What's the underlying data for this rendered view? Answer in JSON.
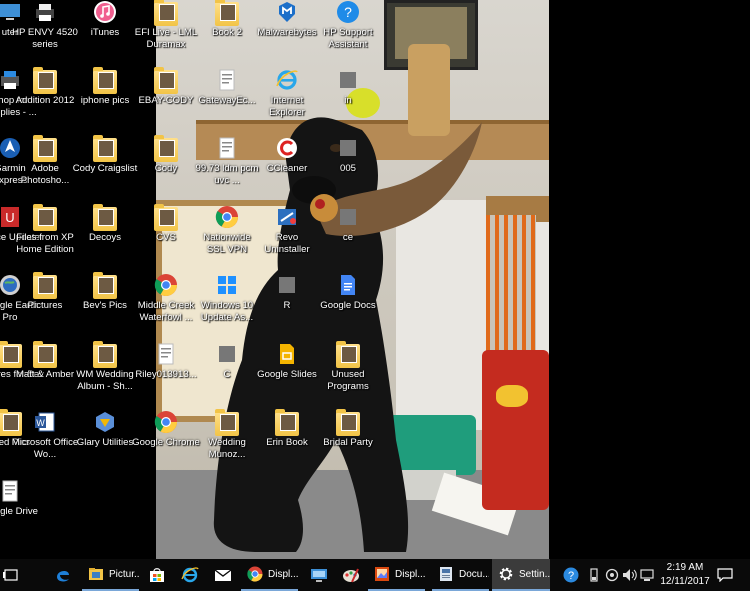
{
  "desktop": {
    "icons": [
      {
        "label": "uter",
        "kind": "computer"
      },
      {
        "label": "HP ENVY 4520 series",
        "kind": "printer"
      },
      {
        "label": "iTunes",
        "kind": "itunes"
      },
      {
        "label": "EFI Live - LML Duramax",
        "kind": "folder"
      },
      {
        "label": "Book 2",
        "kind": "folder"
      },
      {
        "label": "Malwarebytes",
        "kind": "malwarebytes"
      },
      {
        "label": "HP Support Assistant",
        "kind": "hp-support"
      },
      {
        "label": "Shop for Supplies - ...",
        "kind": "shop"
      },
      {
        "label": "Addition 2012",
        "kind": "folder"
      },
      {
        "label": "iphone pics",
        "kind": "folder"
      },
      {
        "label": "EBAY-CODY",
        "kind": "folder"
      },
      {
        "label": "GatewayEc...",
        "kind": "doc"
      },
      {
        "label": "Internet Explorer",
        "kind": "ie"
      },
      {
        "label": "in",
        "kind": "generic"
      },
      {
        "label": "Garmin Express",
        "kind": "garmin"
      },
      {
        "label": "Adobe Photosho...",
        "kind": "folder"
      },
      {
        "label": "Cody Craigslist",
        "kind": "folder"
      },
      {
        "label": "Cody",
        "kind": "folder"
      },
      {
        "label": "99.73 ldm pcm uvc ...",
        "kind": "doc"
      },
      {
        "label": "CCleaner",
        "kind": "ccleaner"
      },
      {
        "label": "005",
        "kind": "generic"
      },
      {
        "label": "Device Updater",
        "kind": "device-updater"
      },
      {
        "label": "Files from XP Home Edition",
        "kind": "folder"
      },
      {
        "label": "Decoys",
        "kind": "folder"
      },
      {
        "label": "CVS",
        "kind": "folder"
      },
      {
        "label": "Nationwide SSL VPN",
        "kind": "chrome"
      },
      {
        "label": "Revo Uninstaller",
        "kind": "revo"
      },
      {
        "label": "ce",
        "kind": "generic"
      },
      {
        "label": "Google Earth Pro",
        "kind": "google-earth"
      },
      {
        "label": "Pictures",
        "kind": "folder"
      },
      {
        "label": "Bev's Pics",
        "kind": "folder"
      },
      {
        "label": "Middle Creek Waterfowl ...",
        "kind": "chrome"
      },
      {
        "label": "Windows 10 Update As...",
        "kind": "windows"
      },
      {
        "label": "R",
        "kind": "generic"
      },
      {
        "label": "Google Docs",
        "kind": "google-docs"
      },
      {
        "label": "Pictures for Bev",
        "kind": "folder"
      },
      {
        "label": "Matt & Amber",
        "kind": "folder"
      },
      {
        "label": "WM Wedding Album - Sh...",
        "kind": "folder"
      },
      {
        "label": "Riley013913...",
        "kind": "doc"
      },
      {
        "label": "C",
        "kind": "generic"
      },
      {
        "label": "Google Slides",
        "kind": "google-slides"
      },
      {
        "label": "Unused Programs",
        "kind": "folder"
      },
      {
        "label": "Wed Pics",
        "kind": "folder"
      },
      {
        "label": "Microsoft Office Wo...",
        "kind": "word"
      },
      {
        "label": "Glary Utilities",
        "kind": "glary"
      },
      {
        "label": "Google Chrome",
        "kind": "chrome"
      },
      {
        "label": "Wedding Munoz...",
        "kind": "folder"
      },
      {
        "label": "Erin Book",
        "kind": "folder"
      },
      {
        "label": "Bridal Party",
        "kind": "folder"
      },
      {
        "label": "Google Drive",
        "kind": "doc"
      }
    ]
  },
  "taskbar": {
    "pinned": [
      {
        "name": "task-view-icon"
      },
      {
        "name": "edge-icon"
      },
      {
        "name": "store-icon"
      },
      {
        "name": "ie-icon"
      },
      {
        "name": "mail-icon"
      }
    ],
    "apps": [
      {
        "label": "Pictur...",
        "icon": "file-explorer-icon",
        "active": false
      },
      {
        "label": "Displ...",
        "icon": "chrome-icon",
        "active": false
      },
      {
        "label": "Displ...",
        "icon": "photos-icon",
        "active": false
      },
      {
        "label": "Docu...",
        "icon": "document-icon",
        "active": false
      },
      {
        "label": "Settin...",
        "icon": "gear-icon",
        "active": true
      }
    ],
    "tray": {
      "time": "2:19 AM",
      "date": "12/11/2017"
    }
  },
  "colors": {
    "taskbar": "#0a0a0a",
    "accent": "#7aa7d8",
    "folder": "#f2c447"
  }
}
